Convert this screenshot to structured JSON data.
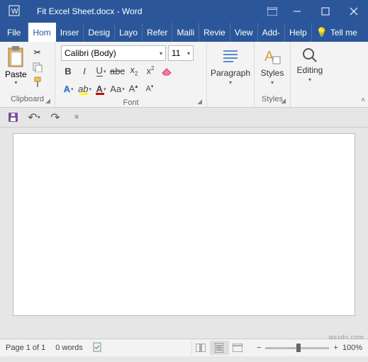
{
  "title": "Fit Excel Sheet.docx - Word",
  "tabs": {
    "file": "File",
    "home": "Hom",
    "insert": "Inser",
    "design": "Desig",
    "layout": "Layo",
    "references": "Refer",
    "mailings": "Maili",
    "review": "Revie",
    "view": "View",
    "addins": "Add-",
    "help": "Help"
  },
  "tellme": "Tell me",
  "font": {
    "name": "Calibri (Body)",
    "size": "11"
  },
  "groups": {
    "clipboard": "Clipboard",
    "font": "Font",
    "paragraph": "Paragraph",
    "styles": "Styles",
    "editing": "Editing",
    "paste": "Paste"
  },
  "status": {
    "page": "Page 1 of 1",
    "words": "0 words",
    "zoom": "100%"
  },
  "watermark": "wsxdn.com"
}
